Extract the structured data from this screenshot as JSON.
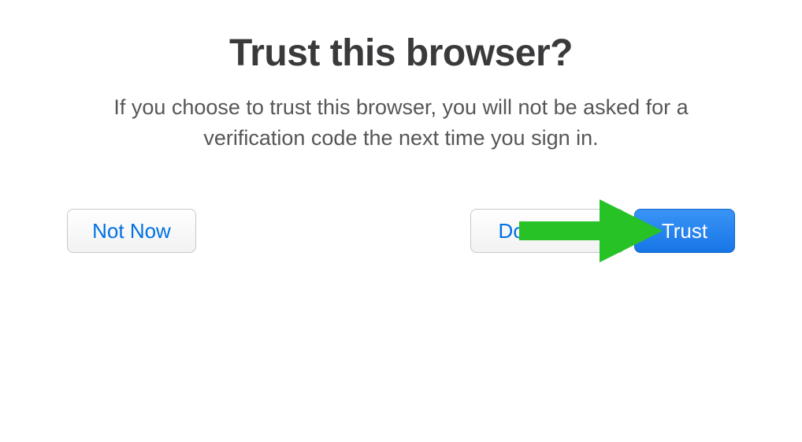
{
  "dialog": {
    "title": "Trust this browser?",
    "description": "If you choose to trust this browser, you will not be asked for a verification code the next time you sign in.",
    "buttons": {
      "not_now": "Not Now",
      "dont_trust": "Don't Trust",
      "trust": "Trust"
    }
  },
  "annotation": {
    "arrow_color": "#26c226"
  }
}
